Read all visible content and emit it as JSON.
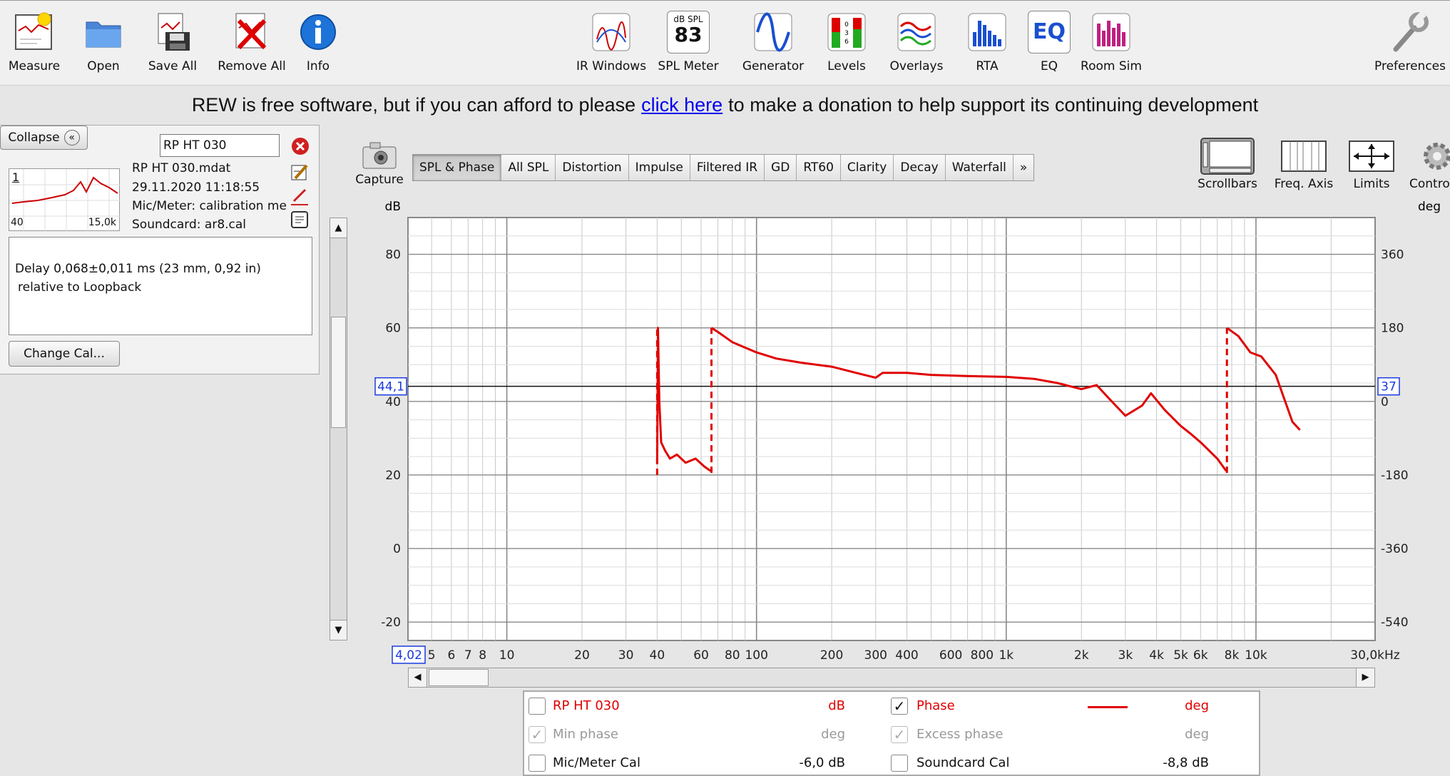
{
  "toolbar": {
    "left": [
      {
        "label": "Measure",
        "icon": "measure-icon"
      },
      {
        "label": "Open",
        "icon": "folder-icon"
      },
      {
        "label": "Save All",
        "icon": "save-icon"
      },
      {
        "label": "Remove All",
        "icon": "remove-icon"
      },
      {
        "label": "Info",
        "icon": "info-icon"
      }
    ],
    "center": [
      {
        "label": "IR Windows",
        "icon": "ir-windows-icon"
      },
      {
        "label": "SPL Meter",
        "icon": "spl-meter-icon",
        "meter_top": "dB SPL",
        "meter_value": "83"
      },
      {
        "label": "Generator",
        "icon": "generator-icon"
      },
      {
        "label": "Levels",
        "icon": "levels-icon"
      },
      {
        "label": "Overlays",
        "icon": "overlays-icon"
      },
      {
        "label": "RTA",
        "icon": "rta-icon"
      },
      {
        "label": "EQ",
        "icon": "eq-icon",
        "icon_text": "EQ"
      },
      {
        "label": "Room Sim",
        "icon": "room-sim-icon"
      }
    ],
    "preferences": {
      "label": "Preferences",
      "icon": "wrench-icon"
    }
  },
  "banner": {
    "before": "REW is free software, but if you can afford to please",
    "link": "click here",
    "after": "to make a donation to help support its continuing development"
  },
  "panel": {
    "collapse_label": "Collapse",
    "measurement_name": "RP HT 030",
    "thumb_index": "1",
    "thumb_min": "40",
    "thumb_max": "15,0k",
    "file": "RP HT 030.mdat",
    "date": "29.11.2020 11:18:55",
    "mic": "Mic/Meter: calibration me",
    "soundcard": "Soundcard: ar8.cal",
    "notes_line1": "Delay 0,068±0,011 ms (23 mm, 0,92 in)",
    "notes_line2": "relative to Loopback",
    "change_cal": "Change Cal..."
  },
  "graph": {
    "capture_label": "Capture",
    "tabs": [
      "SPL & Phase",
      "All SPL",
      "Distortion",
      "Impulse",
      "Filtered IR",
      "GD",
      "RT60",
      "Clarity",
      "Decay",
      "Waterfall",
      "»"
    ],
    "active_tab": 0,
    "tools": [
      {
        "label": "Scrollbars",
        "icon": "scrollbars-icon"
      },
      {
        "label": "Freq. Axis",
        "icon": "freq-axis-icon"
      },
      {
        "label": "Limits",
        "icon": "limits-icon"
      },
      {
        "label": "Contro",
        "icon": "gear-icon"
      }
    ]
  },
  "chart_data": {
    "type": "line",
    "xscale": "log",
    "xlim": [
      4.02,
      30000
    ],
    "ylabel": "dB",
    "ylim": [
      -25,
      90
    ],
    "y2label": "deg",
    "y2lim": [
      -585,
      450
    ],
    "yticks": [
      80,
      60,
      40,
      20,
      0,
      -20
    ],
    "y2ticks": [
      360,
      180,
      0,
      -180,
      -360,
      -540
    ],
    "xticks": [
      {
        "v": 5,
        "l": "5"
      },
      {
        "v": 6,
        "l": "6"
      },
      {
        "v": 7,
        "l": "7"
      },
      {
        "v": 8,
        "l": "8"
      },
      {
        "v": 10,
        "l": "10"
      },
      {
        "v": 20,
        "l": "20"
      },
      {
        "v": 30,
        "l": "30"
      },
      {
        "v": 40,
        "l": "40"
      },
      {
        "v": 60,
        "l": "60"
      },
      {
        "v": 80,
        "l": "80"
      },
      {
        "v": 100,
        "l": "100"
      },
      {
        "v": 200,
        "l": "200"
      },
      {
        "v": 300,
        "l": "300"
      },
      {
        "v": 400,
        "l": "400"
      },
      {
        "v": 600,
        "l": "600"
      },
      {
        "v": 800,
        "l": "800"
      },
      {
        "v": 1000,
        "l": "1k"
      },
      {
        "v": 2000,
        "l": "2k"
      },
      {
        "v": 3000,
        "l": "3k"
      },
      {
        "v": 4000,
        "l": "4k"
      },
      {
        "v": 5000,
        "l": "5k"
      },
      {
        "v": 6000,
        "l": "6k"
      },
      {
        "v": 8000,
        "l": "8k"
      },
      {
        "v": 10000,
        "l": "10k"
      },
      {
        "v": 30000,
        "l": "30,0kHz"
      }
    ],
    "x_start_label": "4,02",
    "cursor": {
      "y_label": "44,1",
      "y2_label": "37",
      "y": 44.1
    },
    "series": [
      {
        "name": "Phase",
        "axis": "deg",
        "color": "#e00000",
        "segments": [
          [
            [
              40,
              -150
            ],
            [
              40.3,
              180
            ],
            [
              40.8,
              0
            ],
            [
              41.5,
              -100
            ],
            [
              43,
              -120
            ],
            [
              45,
              -140
            ],
            [
              48,
              -130
            ],
            [
              52,
              -150
            ],
            [
              57,
              -140
            ],
            [
              62,
              -160
            ],
            [
              65.5,
              -170
            ]
          ],
          [
            [
              66,
              180
            ],
            [
              70,
              170
            ],
            [
              80,
              145
            ],
            [
              100,
              120
            ],
            [
              120,
              105
            ],
            [
              150,
              95
            ],
            [
              200,
              85
            ],
            [
              250,
              70
            ],
            [
              300,
              58
            ],
            [
              320,
              70
            ],
            [
              400,
              70
            ],
            [
              500,
              65
            ],
            [
              700,
              62
            ],
            [
              1000,
              60
            ],
            [
              1300,
              55
            ],
            [
              1600,
              45
            ],
            [
              2000,
              30
            ],
            [
              2300,
              40
            ],
            [
              2600,
              5
            ],
            [
              3000,
              -35
            ],
            [
              3500,
              -10
            ],
            [
              3800,
              20
            ],
            [
              4300,
              -20
            ],
            [
              5000,
              -60
            ],
            [
              5500,
              -80
            ],
            [
              6000,
              -100
            ],
            [
              7000,
              -140
            ],
            [
              7600,
              -170
            ]
          ],
          [
            [
              7650,
              180
            ],
            [
              8500,
              160
            ],
            [
              9500,
              120
            ],
            [
              10500,
              110
            ],
            [
              12000,
              65
            ],
            [
              14000,
              -50
            ],
            [
              15000,
              -70
            ]
          ]
        ],
        "jumps": [
          [
            40,
            -180,
            180
          ],
          [
            66,
            -175,
            180
          ],
          [
            7650,
            -175,
            180
          ]
        ]
      }
    ]
  },
  "legend": {
    "rows": [
      {
        "left_label": "RP HT 030",
        "left_unit": "dB",
        "left_checked": false,
        "left_grey": false,
        "left_color": "#e00000",
        "right_label": "Phase",
        "right_unit": "deg",
        "right_checked": true,
        "right_grey": false,
        "right_color": "#e00000"
      },
      {
        "left_label": "Min phase",
        "left_unit": "deg",
        "left_checked": true,
        "left_grey": true,
        "left_color": "#999999",
        "right_label": "Excess phase",
        "right_unit": "deg",
        "right_checked": true,
        "right_grey": true,
        "right_color": "#999999"
      },
      {
        "left_label": "Mic/Meter Cal",
        "left_unit": "-6,0 dB",
        "left_checked": false,
        "left_grey": false,
        "left_color": "#111111",
        "right_label": "Soundcard Cal",
        "right_unit": "-8,8 dB",
        "right_checked": false,
        "right_grey": false,
        "right_color": "#111111"
      }
    ]
  }
}
